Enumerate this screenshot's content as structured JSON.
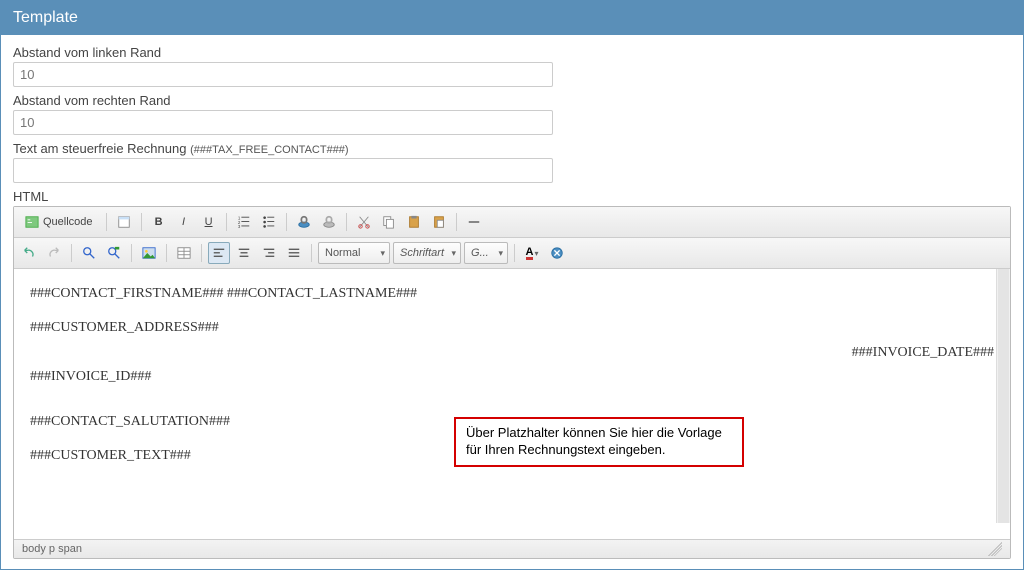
{
  "panel": {
    "title": "Template"
  },
  "fields": {
    "left_margin": {
      "label": "Abstand vom linken Rand",
      "value": "10"
    },
    "right_margin": {
      "label": "Abstand vom rechten Rand",
      "value": "10"
    },
    "tax_free_text": {
      "label": "Text am steuerfreie Rechnung",
      "hint": "(###TAX_FREE_CONTACT###)",
      "value": ""
    },
    "html_label": "HTML"
  },
  "toolbar": {
    "source_label": "Quellcode",
    "format_select": "Normal",
    "font_select": "Schriftart",
    "size_select": "G..."
  },
  "editor_content": {
    "line1": "###CONTACT_FIRSTNAME### ###CONTACT_LASTNAME###",
    "line2": "###CUSTOMER_ADDRESS###",
    "line3_right": "###INVOICE_DATE###",
    "line4": "###INVOICE_ID###",
    "line5": "###CONTACT_SALUTATION###",
    "line6": "###CUSTOMER_TEXT###"
  },
  "callout": {
    "text": "Über Platzhalter können Sie hier die Vorlage für Ihren Rechnungstext eingeben."
  },
  "editor_footer": {
    "path": "body  p  span"
  }
}
